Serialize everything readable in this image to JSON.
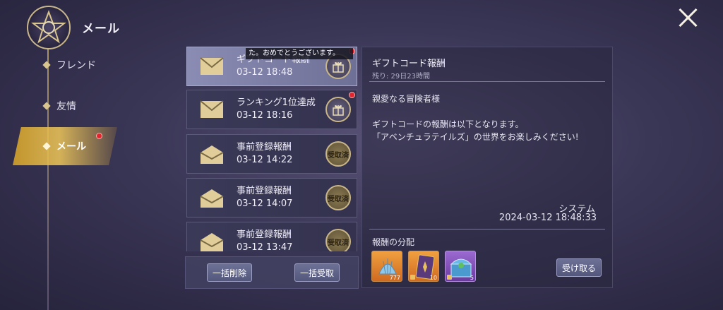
{
  "nav": {
    "title": "メール",
    "items": [
      {
        "label": "フレンド"
      },
      {
        "label": "友情"
      },
      {
        "label": "メール"
      }
    ]
  },
  "toast": "た。おめでとうございます。",
  "mails": [
    {
      "title": "ギフトコード報酬",
      "date": "03-12 18:48",
      "stamp": ""
    },
    {
      "title": "ランキング1位達成",
      "date": "03-12 18:16",
      "stamp": ""
    },
    {
      "title": "事前登録報酬",
      "date": "03-12 14:22",
      "stamp": "受取済"
    },
    {
      "title": "事前登録報酬",
      "date": "03-12 14:07",
      "stamp": "受取済"
    },
    {
      "title": "事前登録報酬",
      "date": "03-12 13:47",
      "stamp": "受取済"
    }
  ],
  "footer": {
    "delete_all": "一括削除",
    "receive_all": "一括受取"
  },
  "detail": {
    "title": "ギフトコード報酬",
    "remaining": "残り: 29日23時間",
    "greeting": "親愛なる冒険者様",
    "body_line1": "ギフトコードの報酬は以下となります。",
    "body_line2": "「アベンチュラテイルズ」の世界をお楽しみください!",
    "sender": "システム",
    "datetime": "2024-03-12  18:48:33",
    "reward_label": "報酬の分配",
    "rewards": [
      {
        "icon": "shell-icon",
        "count": "777"
      },
      {
        "icon": "card-icon",
        "count": "10"
      },
      {
        "icon": "chest-icon",
        "count": "5"
      }
    ],
    "receive_button": "受け取る"
  },
  "colors": {
    "accent_gold": "#d9c58e",
    "notify_red": "#e0252f",
    "selected_mail": "#8a8cb4"
  }
}
